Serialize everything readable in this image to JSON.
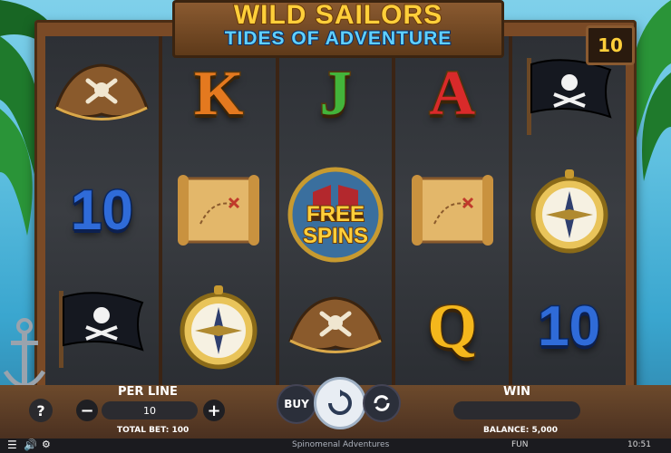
{
  "title": {
    "line1": "WILD SAILORS",
    "line2": "TIDES OF ADVENTURE"
  },
  "lines_count": "10",
  "reels": [
    [
      "pirate-hat",
      "10",
      "pirate-flag"
    ],
    [
      "K",
      "treasure-map",
      "compass"
    ],
    [
      "J",
      "free-spins",
      "pirate-hat"
    ],
    [
      "A",
      "treasure-map",
      "Q"
    ],
    [
      "pirate-flag",
      "compass",
      "10"
    ]
  ],
  "symbols": {
    "K": "K",
    "J": "J",
    "A": "A",
    "Q": "Q",
    "ten": "10",
    "free_spins_line1": "FREE",
    "free_spins_line2": "SPINS"
  },
  "colors": {
    "K": "#e4791f",
    "J": "#43b43a",
    "A": "#d92a2a",
    "Q": "#f4b71c",
    "ten": "#2f6bd8"
  },
  "controls": {
    "help": "?",
    "per_line_label": "PER LINE",
    "per_line_value": "10",
    "minus": "−",
    "plus": "+",
    "total_bet": "TOTAL BET: 100",
    "buy": "BUY",
    "win_label": "WIN",
    "balance": "BALANCE: 5,000"
  },
  "footer": {
    "brand": "Spinomenal Adventures",
    "mode": "FUN",
    "time": "10:51"
  }
}
